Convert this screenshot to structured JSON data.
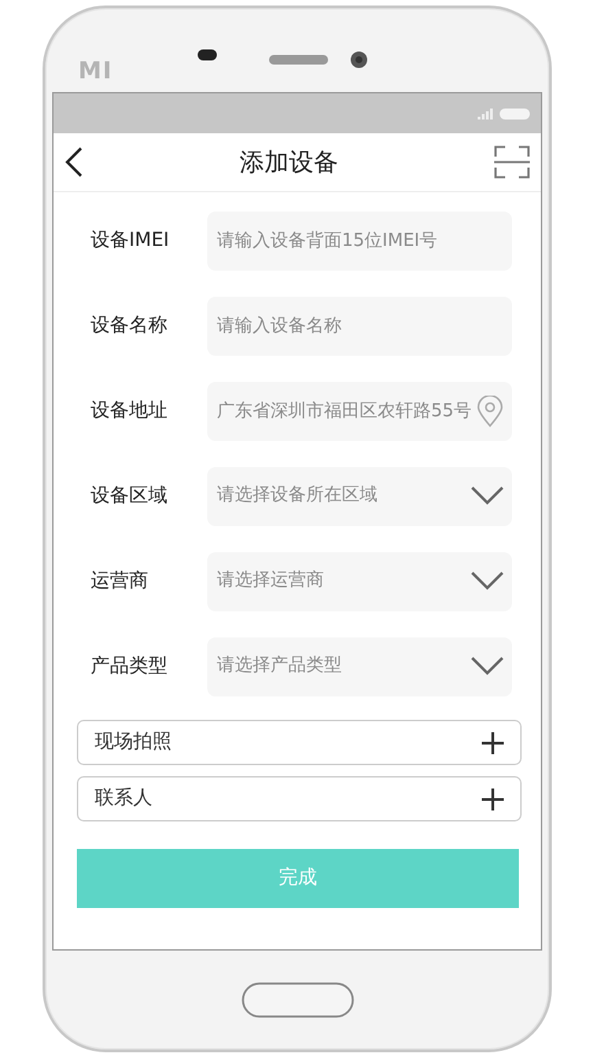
{
  "device": {
    "logo": "MI"
  },
  "header": {
    "title": "添加设备"
  },
  "form_rows": [
    {
      "kind": "input",
      "label": "设备IMEI",
      "placeholder": "请输入设备背面15位IMEI号"
    },
    {
      "kind": "input",
      "label": "设备名称",
      "placeholder": "请输入设备名称"
    },
    {
      "kind": "location",
      "label": "设备地址",
      "value": "广东省深圳市福田区农轩路55号"
    },
    {
      "kind": "select",
      "label": "设备区域",
      "placeholder": "请选择设备所在区域"
    },
    {
      "kind": "select",
      "label": "运营商",
      "placeholder": "请选择运营商"
    },
    {
      "kind": "select",
      "label": "产品类型",
      "placeholder": "请选择产品类型"
    }
  ],
  "expand_rows": [
    {
      "label": "现场拍照"
    },
    {
      "label": "联系人"
    }
  ],
  "submit": {
    "label": "完成"
  }
}
